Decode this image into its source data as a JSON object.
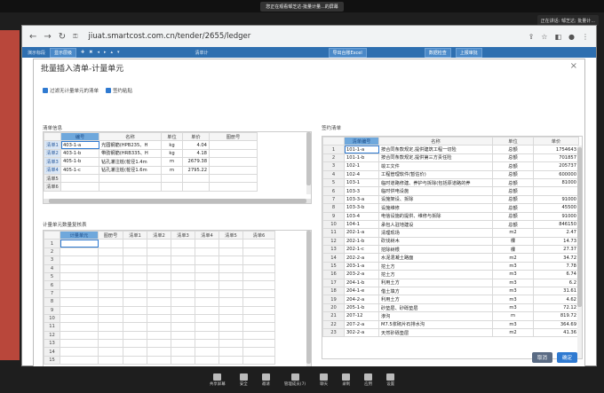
{
  "meeting": {
    "banner": "您正在观看邹芝达-批量计量...的屏幕",
    "side_label": "正在讲话: 邹芝达; 批量计..."
  },
  "browser": {
    "url": "jiuat.smartcost.com.cn/tender/2655/ledger"
  },
  "app": {
    "tab": "演示标段",
    "tool1": "显示层级",
    "tool2": "清单计",
    "btn1": "导出台账Excel",
    "btn2": "数据检查",
    "btn3": "上报审批"
  },
  "dialog": {
    "title": "批量插入清单-计量单元",
    "opt1": "过滤无计量单元的清单",
    "opt2": "签约粘贴",
    "sec_bills": "清单信息",
    "sec_units": "计量单元数量复核表",
    "sec_contract": "签约清单",
    "cancel": "取消",
    "confirm": "确定"
  },
  "colors": {
    "primary": "#2f7ad1",
    "header_hl": "#6fa8dc"
  },
  "bills": {
    "headers": [
      "",
      "编号",
      "名称",
      "单位",
      "单价",
      "图册号"
    ],
    "rows": [
      [
        "清单1",
        "403-1-a",
        "光圆钢筋(HPB235、H",
        "kg",
        "4.04",
        ""
      ],
      [
        "清单2",
        "403-1-b",
        "带肋钢筋(HRB335、H",
        "kg",
        "4.18",
        ""
      ],
      [
        "清单3",
        "405-1-b",
        "钻孔灌注桩(桩径1.4m",
        "m",
        "2679.38",
        ""
      ],
      [
        "清单4",
        "405-1-c",
        "钻孔灌注桩(桩径1.6m",
        "m",
        "2795.22",
        ""
      ],
      [
        "清单5",
        "",
        "",
        "",
        "",
        ""
      ],
      [
        "清单6",
        "",
        "",
        "",
        "",
        ""
      ]
    ]
  },
  "units": {
    "headers": [
      "",
      "计量单元",
      "图册号",
      "清单1",
      "清单2",
      "清单3",
      "清单4",
      "清单5",
      "清单6"
    ],
    "rows": [
      "1",
      "2",
      "3",
      "4",
      "5",
      "6",
      "7",
      "8",
      "9",
      "10",
      "11",
      "12",
      "13",
      "14",
      "15"
    ]
  },
  "contract": {
    "headers": [
      "",
      "清单编号",
      "名称",
      "单位",
      "单价"
    ],
    "rows": [
      [
        "1",
        "101-1-a",
        "按合同条款规定,提供建筑工程一切险",
        "总额",
        "1754643"
      ],
      [
        "2",
        "101-1-b",
        "按合同条款规定,提供第三方责任险",
        "总额",
        "701857"
      ],
      [
        "3",
        "102-1",
        "竣工文件",
        "总额",
        "205737"
      ],
      [
        "4",
        "102-4",
        "工程管理软件(暂估价)",
        "总额",
        "600000"
      ],
      [
        "5",
        "103-1",
        "临时道路修建、养护与拆除(包括原道路的养",
        "总额",
        "81000"
      ],
      [
        "6",
        "103-3",
        "临时供电设施",
        "总额",
        ""
      ],
      [
        "7",
        "103-3-a",
        "设施架设、拆除",
        "总额",
        "91000"
      ],
      [
        "8",
        "103-3-b",
        "设施维修",
        "总额",
        "45500"
      ],
      [
        "9",
        "103-4",
        "电信设施的提供、维修与拆除",
        "总额",
        "91000"
      ],
      [
        "10",
        "104-1",
        "承包人驻地建设",
        "总额",
        "846150"
      ],
      [
        "11",
        "202-1-a",
        "清理现场",
        "m2",
        "2.47"
      ],
      [
        "12",
        "202-1-b",
        "砍伐树木",
        "棵",
        "14.73"
      ],
      [
        "13",
        "202-1-c",
        "挖除树根",
        "棵",
        "27.37"
      ],
      [
        "14",
        "202-2-a",
        "水泥混凝土路面",
        "m2",
        "34.72"
      ],
      [
        "15",
        "203-1-a",
        "挖土方",
        "m3",
        "7.78"
      ],
      [
        "16",
        "203-2-a",
        "挖土方",
        "m3",
        "6.74"
      ],
      [
        "17",
        "204-1-b",
        "利用土方",
        "m3",
        "6.2"
      ],
      [
        "18",
        "204-1-e",
        "借土填方",
        "m3",
        "31.61"
      ],
      [
        "19",
        "204-2-a",
        "利用土方",
        "m3",
        "4.62"
      ],
      [
        "20",
        "205-1-b",
        "砂垫层、砂砾垫层",
        "m3",
        "72.12"
      ],
      [
        "21",
        "207-12",
        "渗沟",
        "m",
        "819.72"
      ],
      [
        "22",
        "207-2-a",
        "M7.5浆砌片石排水沟",
        "m3",
        "364.69"
      ],
      [
        "23",
        "302-2-a",
        "天然砂砾垫层",
        "m2",
        "41.36"
      ]
    ]
  },
  "toolbar": {
    "items": [
      "共享屏幕",
      "安全",
      "邀请",
      "管理成员(7)",
      "聊天",
      "录制",
      "应用",
      "设置"
    ]
  }
}
